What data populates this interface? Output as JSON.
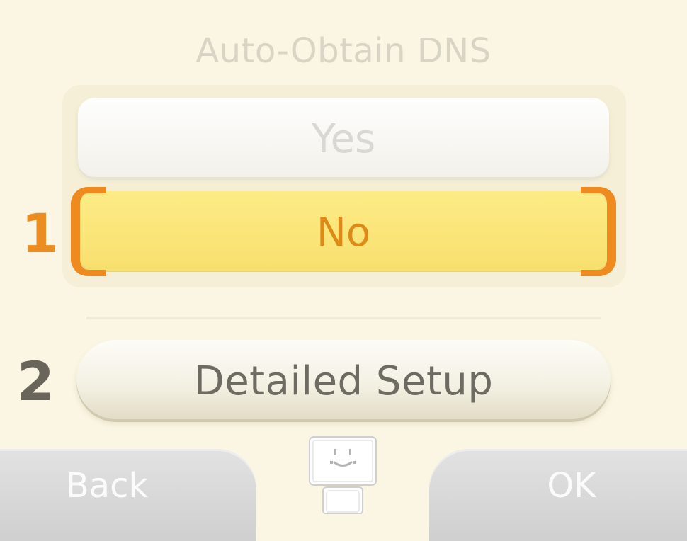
{
  "screen": {
    "title": "Auto-Obtain DNS"
  },
  "options": {
    "yes_label": "Yes",
    "no_label": "No",
    "selected": "No"
  },
  "markers": {
    "first": "1",
    "second": "2"
  },
  "detailed_setup": {
    "label": "Detailed Setup"
  },
  "bottom_bar": {
    "back_label": "Back",
    "ok_label": "OK",
    "home_icon": "home-menu-smiley-icon"
  },
  "colors": {
    "background": "#faf6e3",
    "selected_fill": "#f8e06e",
    "selection_bracket": "#ee8a1e",
    "selected_text": "#de8a18",
    "marker_1": "#ec8d22",
    "marker_2": "#6a655a",
    "bottom_buttons": "#d6d6d6"
  }
}
